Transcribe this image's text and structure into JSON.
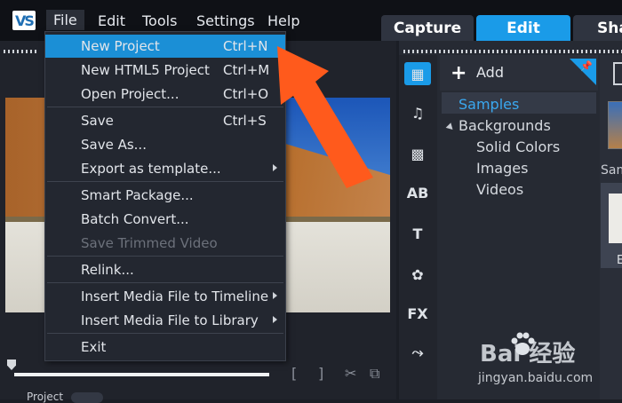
{
  "menubar": {
    "logo_text": "VS",
    "items": [
      "File",
      "Edit",
      "Tools",
      "Settings",
      "Help"
    ],
    "active_item": "File"
  },
  "tabs": [
    "Capture",
    "Edit",
    "Sha"
  ],
  "file_menu": {
    "items": [
      {
        "label": "New Project",
        "shortcut": "Ctrl+N",
        "highlighted": true
      },
      {
        "label": "New HTML5 Project",
        "shortcut": "Ctrl+M"
      },
      {
        "label": "Open Project...",
        "shortcut": "Ctrl+O"
      },
      {
        "label": "Save",
        "shortcut": "Ctrl+S"
      },
      {
        "label": "Save As..."
      },
      {
        "label": "Export as template...",
        "submenu": true
      },
      {
        "label": "Smart Package..."
      },
      {
        "label": "Batch Convert..."
      },
      {
        "label": "Save Trimmed Video",
        "disabled": true
      },
      {
        "label": "Relink..."
      },
      {
        "label": "Insert Media File to Timeline",
        "submenu": true
      },
      {
        "label": "Insert Media File to Library",
        "submenu": true
      },
      {
        "label": "Exit"
      }
    ]
  },
  "library": {
    "add_label": "Add",
    "tree": [
      {
        "label": "Samples",
        "selected": true
      },
      {
        "label": "Backgrounds",
        "expanded": true
      },
      {
        "label": "Solid Colors"
      },
      {
        "label": "Images"
      },
      {
        "label": "Videos"
      }
    ],
    "thumbnail_caption": "Sam",
    "thumbnail_letter": "E",
    "side_icons": [
      "media-icon",
      "music-icon",
      "transition-icon",
      "title-icon",
      "text-icon",
      "graphics-icon",
      "fx-icon",
      "path-icon"
    ],
    "fx_label": "FX",
    "title_label": "AB",
    "text_label": "T"
  },
  "preview": {
    "project_label": "Project"
  },
  "watermark": {
    "text": "Bai  经验",
    "url": "jingyan.baidu.com"
  },
  "colors": {
    "accent": "#1a9be8",
    "arrow": "#ff5a1c"
  }
}
